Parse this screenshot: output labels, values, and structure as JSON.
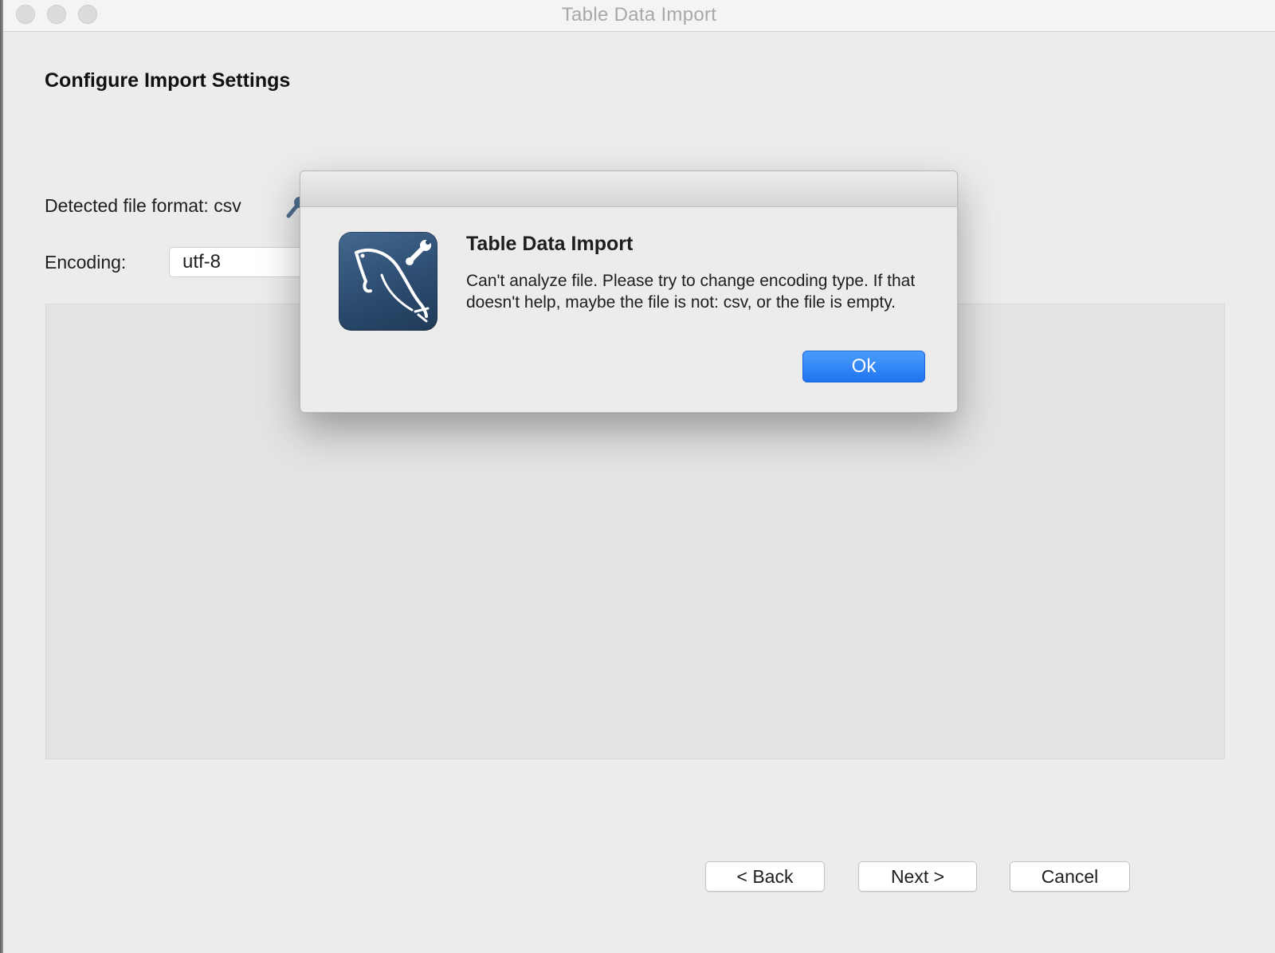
{
  "window": {
    "title": "Table Data Import"
  },
  "page": {
    "section_title": "Configure Import Settings",
    "format_label": "Detected file format: csv",
    "encoding_label": "Encoding:",
    "encoding_value": "utf-8"
  },
  "footer": {
    "back_label": "< Back",
    "next_label": "Next >",
    "cancel_label": "Cancel"
  },
  "dialog": {
    "title": "Table Data Import",
    "message": "Can't analyze file. Please try to change encoding type. If that doesn't help, maybe the file is not: csv, or the file is empty.",
    "ok_label": "Ok",
    "icon": "mysql-workbench-dolphin-icon"
  },
  "colors": {
    "window_bg": "#ececec",
    "accent": "#2a7ff4",
    "icon_bg": "#2c4c70"
  }
}
